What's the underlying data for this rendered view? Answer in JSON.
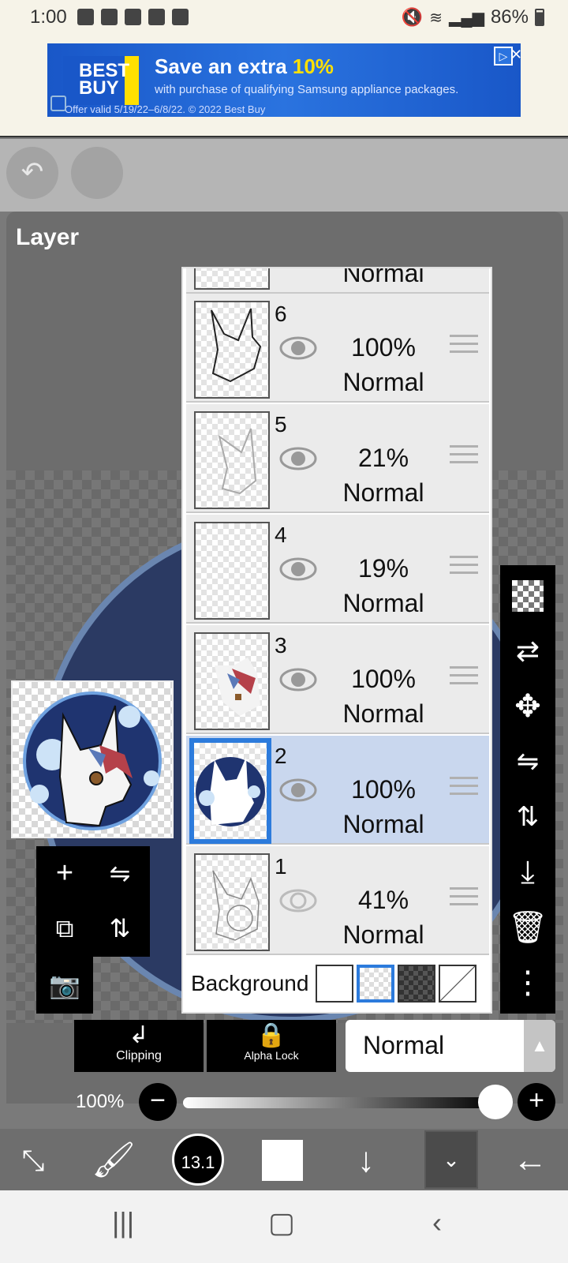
{
  "status_bar": {
    "time": "1:00",
    "battery": "86%"
  },
  "ad": {
    "brand_line1": "BEST",
    "brand_line2": "BUY",
    "headline_prefix": "Save an extra ",
    "headline_highlight": "10%",
    "subline": "with purchase of qualifying Samsung appliance packages.",
    "fine_print": "Offer valid 5/19/22–6/8/22. © 2022 Best Buy"
  },
  "panel": {
    "title": "Layer"
  },
  "layers": [
    {
      "number": "6",
      "opacity": "100%",
      "mode": "Normal"
    },
    {
      "number": "5",
      "opacity": "21%",
      "mode": "Normal"
    },
    {
      "number": "4",
      "opacity": "19%",
      "mode": "Normal"
    },
    {
      "number": "3",
      "opacity": "100%",
      "mode": "Normal"
    },
    {
      "number": "2",
      "opacity": "100%",
      "mode": "Normal"
    },
    {
      "number": "1",
      "opacity": "41%",
      "mode": "Normal"
    }
  ],
  "partial_top_mode": "Normal",
  "background": {
    "label": "Background"
  },
  "blend": {
    "clipping_label": "Clipping",
    "alpha_lock_label": "Alpha Lock",
    "mode_value": "Normal"
  },
  "opacity": {
    "label": "100%",
    "value": 1.0
  },
  "bottom_bar": {
    "brush_size": "13.1"
  },
  "colors": {
    "selected_layer_bg": "#c9d7ee",
    "selection_blue": "#2c7bdc",
    "panel_bg": "#6d6d6d",
    "toolbar_black": "#000000"
  }
}
